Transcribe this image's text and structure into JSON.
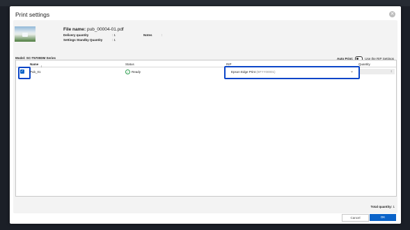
{
  "dialog": {
    "title": "Print settings"
  },
  "file": {
    "name_label": "File name:",
    "name_value": "pub_00004-01.pdf",
    "delivery_label": "Delivery quantity",
    "delivery_value": ": 1",
    "standby_label": "Settings Standby Quantity",
    "standby_value": ": 1",
    "notes_label": "Notes",
    "notes_value": ":"
  },
  "model": {
    "label": "Model: SC-T5700DM Series"
  },
  "auto_print": {
    "label": "Auto Print:",
    "option": "Use the RIP Settings",
    "enabled": false
  },
  "table": {
    "headers": {
      "name": "Name",
      "status": "Status",
      "rip": "RIP",
      "quantity": "Quantity"
    },
    "rows": [
      {
        "checked": true,
        "name": "Pub_01",
        "status": "Ready",
        "rip_name": "Epson Edge Print",
        "rip_id": "(BFYY00001)"
      }
    ]
  },
  "total": {
    "label": "Total quantity:",
    "value": "1"
  },
  "buttons": {
    "cancel": "Cancel",
    "ok": "OK"
  },
  "colors": {
    "accent": "#0a63c9",
    "highlight": "#0a45c8",
    "ready": "#2e9e4f"
  }
}
